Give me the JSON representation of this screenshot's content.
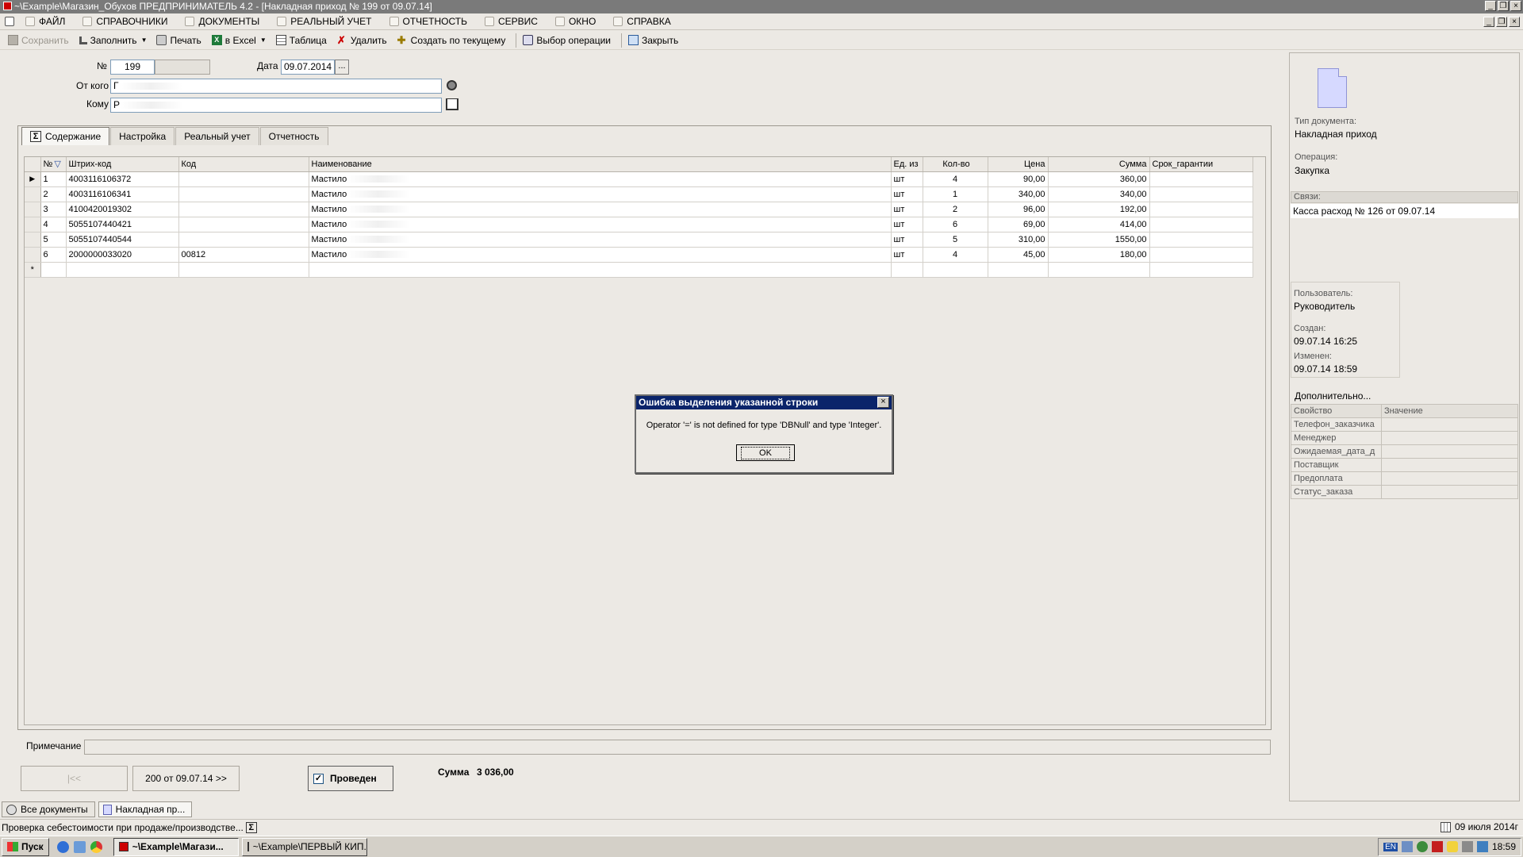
{
  "window": {
    "title": "~\\Example\\Магазин_Обухов  ПРЕДПРИНИМАТЕЛЬ 4.2 - [Накладная приход № 199 от 09.07.14]"
  },
  "menu": [
    "ФАЙЛ",
    "СПРАВОЧНИКИ",
    "ДОКУМЕНТЫ",
    "РЕАЛЬНЫЙ УЧЕТ",
    "ОТЧЕТНОСТЬ",
    "СЕРВИС",
    "ОКНО",
    "СПРАВКА"
  ],
  "toolbar": {
    "save": "Сохранить",
    "fill": "Заполнить",
    "print": "Печать",
    "excel": "в Excel",
    "table": "Таблица",
    "delete": "Удалить",
    "create_from": "Создать по текущему",
    "choose_op": "Выбор операции",
    "close": "Закрыть"
  },
  "form": {
    "number_label": "№",
    "number": "199",
    "date_label": "Дата",
    "date": "09.07.2014",
    "dots": "...",
    "from_label": "От кого",
    "from_value": "Г",
    "to_label": "Кому",
    "to_value": "Р"
  },
  "tabs": [
    "Содержание",
    "Настройка",
    "Реальный учет",
    "Отчетность"
  ],
  "grid": {
    "headers": [
      "№",
      "Штрих-код",
      "Код",
      "Наименование",
      "Ед. из",
      "Кол-во",
      "Цена",
      "Сумма",
      "Срок_гарантии"
    ],
    "rows": [
      {
        "n": "1",
        "barcode": "4003116106372",
        "code": "",
        "name": "Мастило",
        "unit": "шт",
        "qty": "4",
        "price": "90,00",
        "sum": "360,00"
      },
      {
        "n": "2",
        "barcode": "4003116106341",
        "code": "",
        "name": "Мастило",
        "unit": "шт",
        "qty": "1",
        "price": "340,00",
        "sum": "340,00"
      },
      {
        "n": "3",
        "barcode": "4100420019302",
        "code": "",
        "name": "Мастило",
        "unit": "шт",
        "qty": "2",
        "price": "96,00",
        "sum": "192,00"
      },
      {
        "n": "4",
        "barcode": "5055107440421",
        "code": "",
        "name": "Мастило",
        "unit": "шт",
        "qty": "6",
        "price": "69,00",
        "sum": "414,00"
      },
      {
        "n": "5",
        "barcode": "5055107440544",
        "code": "",
        "name": "Мастило",
        "unit": "шт",
        "qty": "5",
        "price": "310,00",
        "sum": "1550,00"
      },
      {
        "n": "6",
        "barcode": "2000000033020",
        "code": "00812",
        "name": "Мастило",
        "unit": "шт",
        "qty": "4",
        "price": "45,00",
        "sum": "180,00"
      }
    ],
    "new_row_marker": "*"
  },
  "bottom": {
    "note_label": "Примечание",
    "prev": "|<<",
    "next": "200 от 09.07.14 >>",
    "posted": "Проведен",
    "sum_label": "Сумма",
    "sum_value": "3 036,00"
  },
  "side": {
    "doctype_label": "Тип документа:",
    "doctype": "Накладная приход",
    "op_label": "Операция:",
    "op": "Закупка",
    "links_label": "Связи:",
    "link": "Касса расход № 126 от 09.07.14",
    "user_label": "Пользователь:",
    "user": "Руководитель",
    "created_label": "Создан:",
    "created": "09.07.14  16:25",
    "changed_label": "Изменен:",
    "changed": "09.07.14  18:59",
    "more": "Дополнительно...",
    "props_headers": [
      "Свойство",
      "Значение"
    ],
    "props": [
      "Телефон_заказчика",
      "Менеджер",
      "Ожидаемая_дата_д",
      "Поставщик",
      "Предоплата",
      "Статус_заказа"
    ]
  },
  "doc_tabs": [
    "Все документы",
    "Накладная пр..."
  ],
  "status": {
    "text": "Проверка себестоимости при продаже/производстве...",
    "date": "09 июля 2014г"
  },
  "taskbar": {
    "start": "Пуск",
    "tasks": [
      "~\\Example\\Магази...",
      "~\\Example\\ПЕРВЫЙ КИП..."
    ],
    "time": "18:59",
    "lang": "EN"
  },
  "dialog": {
    "title": "Ошибка выделения указанной строки",
    "message": "Operator '=' is not defined for type 'DBNull' and type 'Integer'.",
    "ok": "OK",
    "close": "×"
  }
}
